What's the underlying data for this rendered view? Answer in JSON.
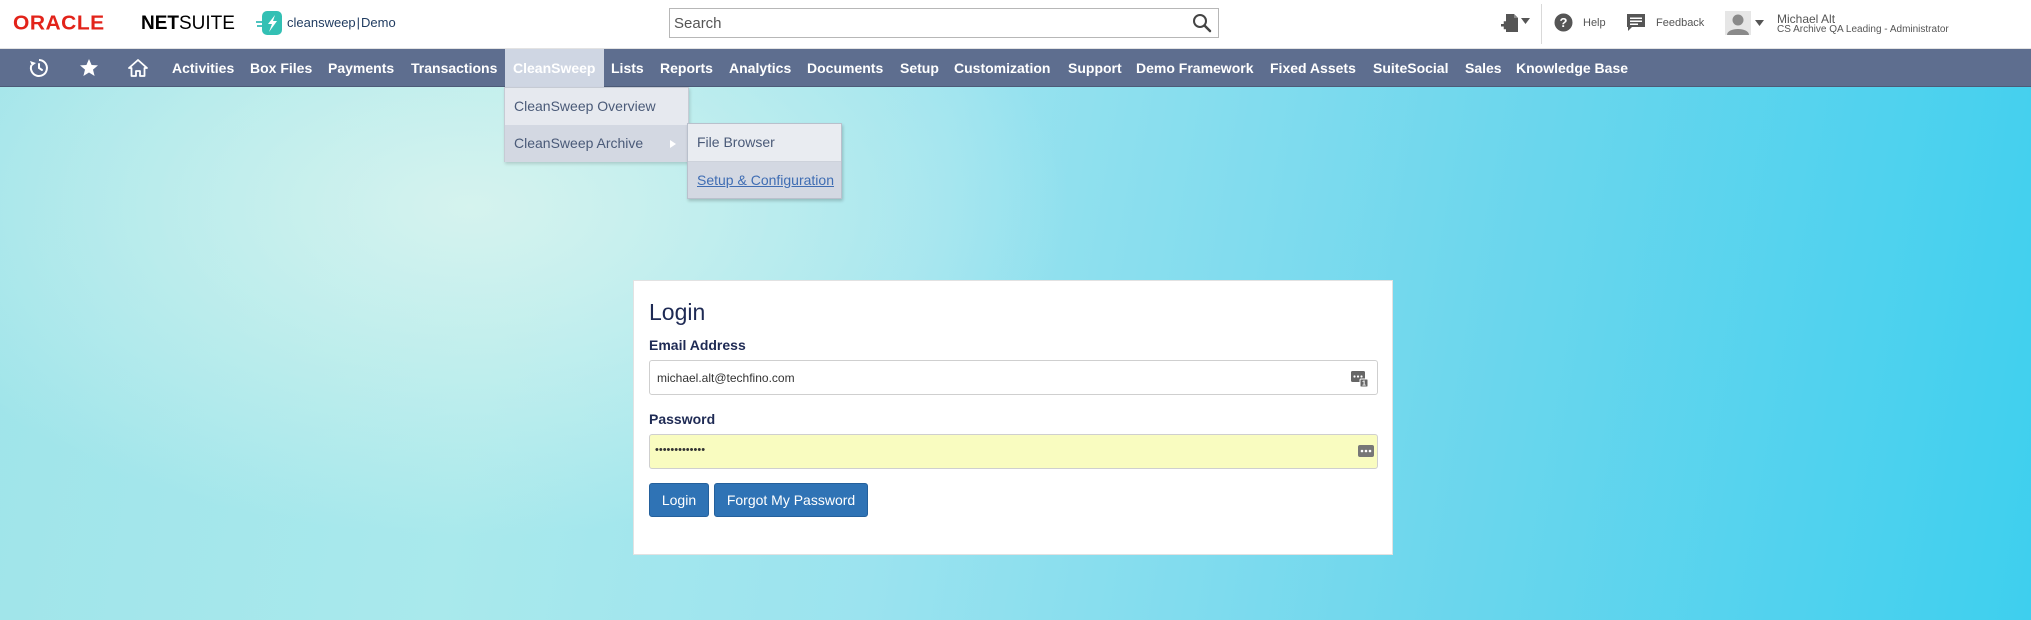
{
  "header": {
    "oracle_logo": "ORACLE",
    "netsuite_logo_bold": "NET",
    "netsuite_logo_rest": "SUITE",
    "account_logo_brand": "cleansweep",
    "account_logo_separator": "|",
    "account_logo_suffix": "Demo",
    "search": {
      "placeholder": "Search",
      "value": ""
    },
    "help_label": "Help",
    "feedback_label": "Feedback",
    "user": {
      "name": "Michael Alt",
      "role": "CS Archive QA Leading - Administrator"
    }
  },
  "nav": {
    "icons": [
      "recent-records-icon",
      "star-icon",
      "home-icon"
    ],
    "items": [
      {
        "label": "Activities"
      },
      {
        "label": "Box Files"
      },
      {
        "label": "Payments"
      },
      {
        "label": "Transactions"
      },
      {
        "label": "CleanSweep",
        "active": true
      },
      {
        "label": "Lists"
      },
      {
        "label": "Reports"
      },
      {
        "label": "Analytics"
      },
      {
        "label": "Documents"
      },
      {
        "label": "Setup"
      },
      {
        "label": "Customization"
      },
      {
        "label": "Support"
      },
      {
        "label": "Demo Framework"
      },
      {
        "label": "Fixed Assets"
      },
      {
        "label": "SuiteSocial"
      },
      {
        "label": "Sales"
      },
      {
        "label": "Knowledge Base"
      }
    ]
  },
  "menu": {
    "items": [
      {
        "label": "CleanSweep Overview"
      },
      {
        "label": "CleanSweep Archive",
        "has_submenu": true
      }
    ],
    "submenu": [
      {
        "label": "File Browser"
      },
      {
        "label": "Setup & Configuration",
        "hover": true
      }
    ]
  },
  "login": {
    "title": "Login",
    "email_label": "Email Address",
    "email_value": "michael.alt@techfino.com",
    "password_label": "Password",
    "password_value": "•••••••••••••",
    "login_button": "Login",
    "forgot_button": "Forgot My Password"
  },
  "colors": {
    "nav_bg": "#5e6e8f",
    "button_blue": "#2f73b5",
    "oracle_red": "#e2231a",
    "password_autofill": "#f9fcc0"
  }
}
